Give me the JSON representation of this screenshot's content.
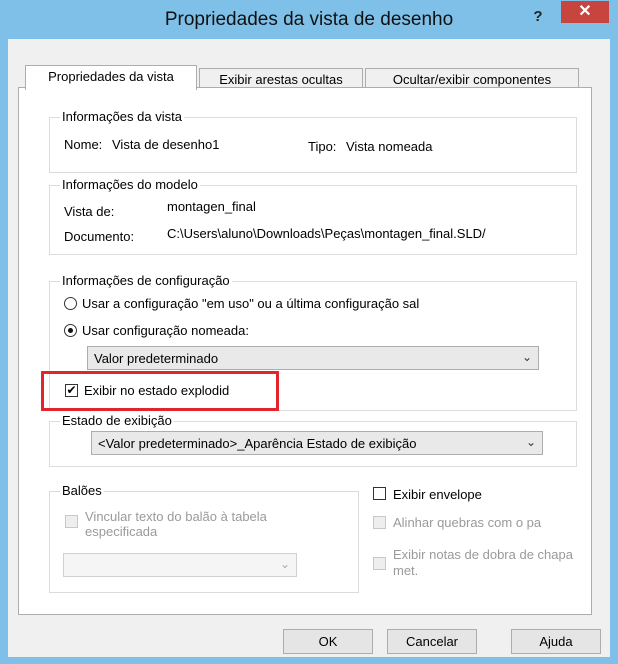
{
  "window": {
    "title": "Propriedades da vista de desenho",
    "help_glyph": "?",
    "close_glyph": "✕",
    "accent": "#7ec0e8",
    "close_color": "#c7443f"
  },
  "tabs": [
    {
      "label": "Propriedades da vista",
      "active": true
    },
    {
      "label": "Exibir arestas ocultas",
      "active": false
    },
    {
      "label": "Ocultar/exibir componentes",
      "active": false
    }
  ],
  "view_info": {
    "legend": "Informações da vista",
    "name_label": "Nome:",
    "name_value": "Vista de desenho1",
    "type_label": "Tipo:",
    "type_value": "Vista nomeada"
  },
  "model_info": {
    "legend": "Informações do modelo",
    "view_of_label": "Vista de:",
    "view_of_value": "montagen_final",
    "document_label": "Documento:",
    "document_value": "C:\\Users\\aluno\\Downloads\\Peças\\montagen_final.SLD/"
  },
  "config_info": {
    "legend": "Informações de configuração",
    "radio_in_use": {
      "label": "Usar a configuração \"em uso\" ou a última configuração sal",
      "checked": false
    },
    "radio_named": {
      "label": "Usar configuração nomeada:",
      "checked": true
    },
    "named_config_value": "Valor predeterminado",
    "exploded_checkbox": {
      "label": "Exibir no estado explodid",
      "checked": true
    },
    "highlight_color": "#e0262a"
  },
  "display_state": {
    "legend": "Estado de exibição",
    "value": "<Valor predeterminado>_Aparência Estado de exibição"
  },
  "balloons": {
    "legend": "Balões",
    "link_text": "Vincular texto do balão à tabela especificada",
    "link_enabled": false,
    "combo_value": ""
  },
  "right_options": {
    "show_envelope": {
      "label": "Exibir envelope",
      "checked": false,
      "enabled": true
    },
    "align_breaks": {
      "label": "Alinhar quebras com o pa",
      "checked": false,
      "enabled": false
    },
    "bend_notes": {
      "label": "Exibir notas de dobra de chapa met.",
      "checked": false,
      "enabled": false
    }
  },
  "footer": {
    "ok_label": "OK",
    "cancel_label": "Cancelar",
    "help_label": "Ajuda"
  }
}
